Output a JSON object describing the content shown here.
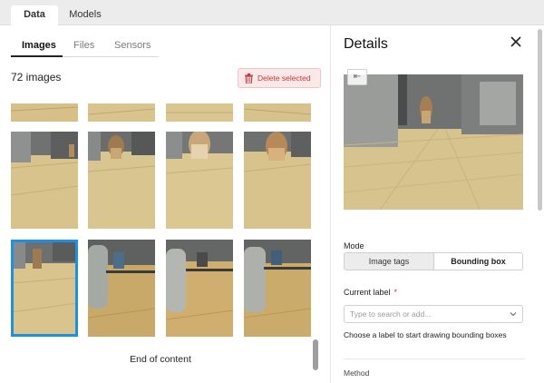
{
  "top_tabs": [
    {
      "label": "Data",
      "active": true
    },
    {
      "label": "Models",
      "active": false
    }
  ],
  "left_panel": {
    "sub_tabs": [
      {
        "label": "Images",
        "active": true
      },
      {
        "label": "Files",
        "active": false
      },
      {
        "label": "Sensors",
        "active": false
      }
    ],
    "image_count_label": "72 images",
    "delete_button_label": "Delete selected",
    "delete_icon": "trash-icon",
    "end_of_content": "End of content",
    "selected_index": 8
  },
  "details": {
    "title": "Details",
    "close_icon": "close-icon",
    "back_icon": "collapse-arrow-icon",
    "back_glyph": "⇤",
    "mode_label": "Mode",
    "mode_options": [
      "Image tags",
      "Bounding box"
    ],
    "mode_selected": "Bounding box",
    "current_label_label": "Current label",
    "required_mark": "*",
    "label_placeholder": "Type to search or add...",
    "label_hint": "Choose a label to start drawing bounding boxes",
    "method_label": "Method"
  },
  "colors": {
    "accent_selected": "#1f8fe0",
    "danger": "#c73636",
    "danger_bg": "#fbe8e8"
  }
}
